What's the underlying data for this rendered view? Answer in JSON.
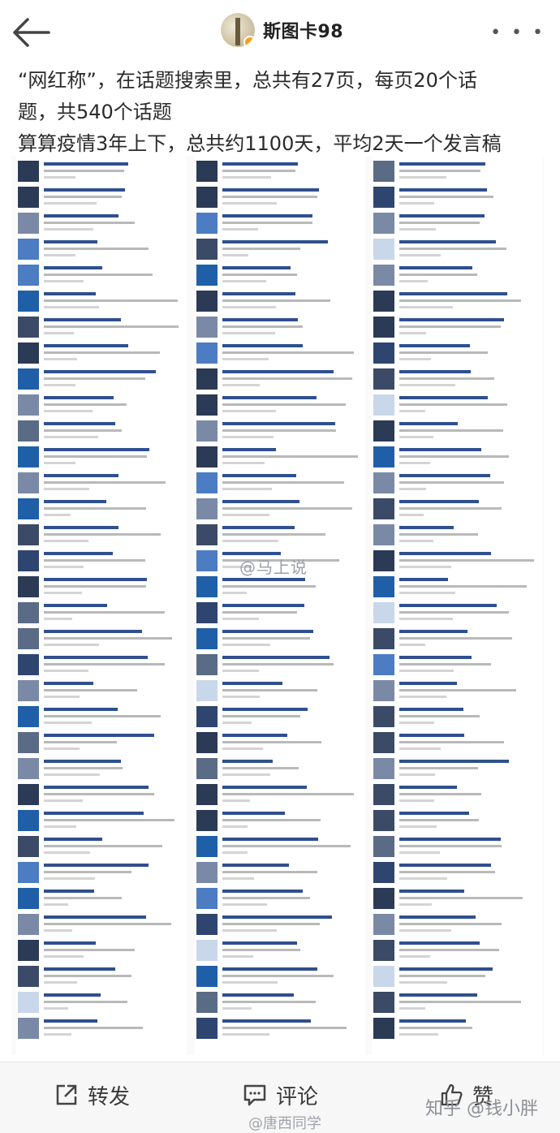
{
  "header": {
    "username": "斯图卡98",
    "icons": [
      "back-arrow-icon",
      "avatar",
      "verified-badge-icon",
      "more-dots-icon"
    ]
  },
  "post": {
    "line1": "“网红称”，在话题搜索里，总共有27页，每页20个话",
    "line2": "题，共540个话题",
    "line3": "算算疫情3年上下，总共约1100天，平均2天一个发言稿"
  },
  "collage": {
    "watermark": "@马上说"
  },
  "footer": {
    "repost_label": "转发",
    "comment_label": "评论",
    "like_label": "赞",
    "watermark_bottom": "@唐西同学",
    "watermark_zhihu": "知乎 @钱小胖"
  },
  "colors": {
    "link_blue": "#2f4f8f",
    "text": "#2a2a2a",
    "bar_bg": "#f7f7f7"
  }
}
